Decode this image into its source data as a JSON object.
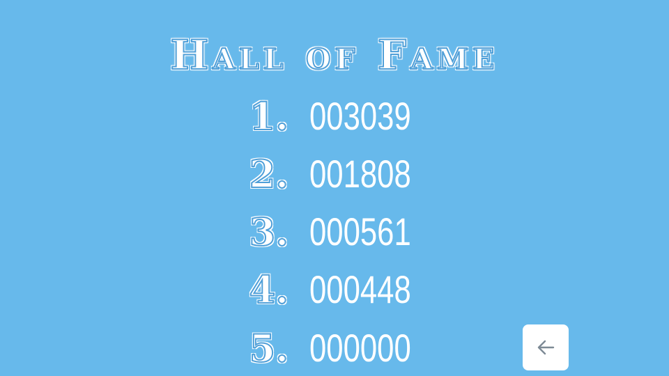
{
  "colors": {
    "background": "#67b9eb",
    "text": "#ffffff",
    "button": "#ffffff",
    "arrow": "#7d8a95"
  },
  "title": "Hall of Fame",
  "leaderboard": [
    {
      "rank": "1.",
      "score": "003039"
    },
    {
      "rank": "2.",
      "score": "001808"
    },
    {
      "rank": "3.",
      "score": "000561"
    },
    {
      "rank": "4.",
      "score": "000448"
    },
    {
      "rank": "5.",
      "score": "000000"
    }
  ],
  "back_button": {
    "icon": "arrow-left-icon"
  }
}
